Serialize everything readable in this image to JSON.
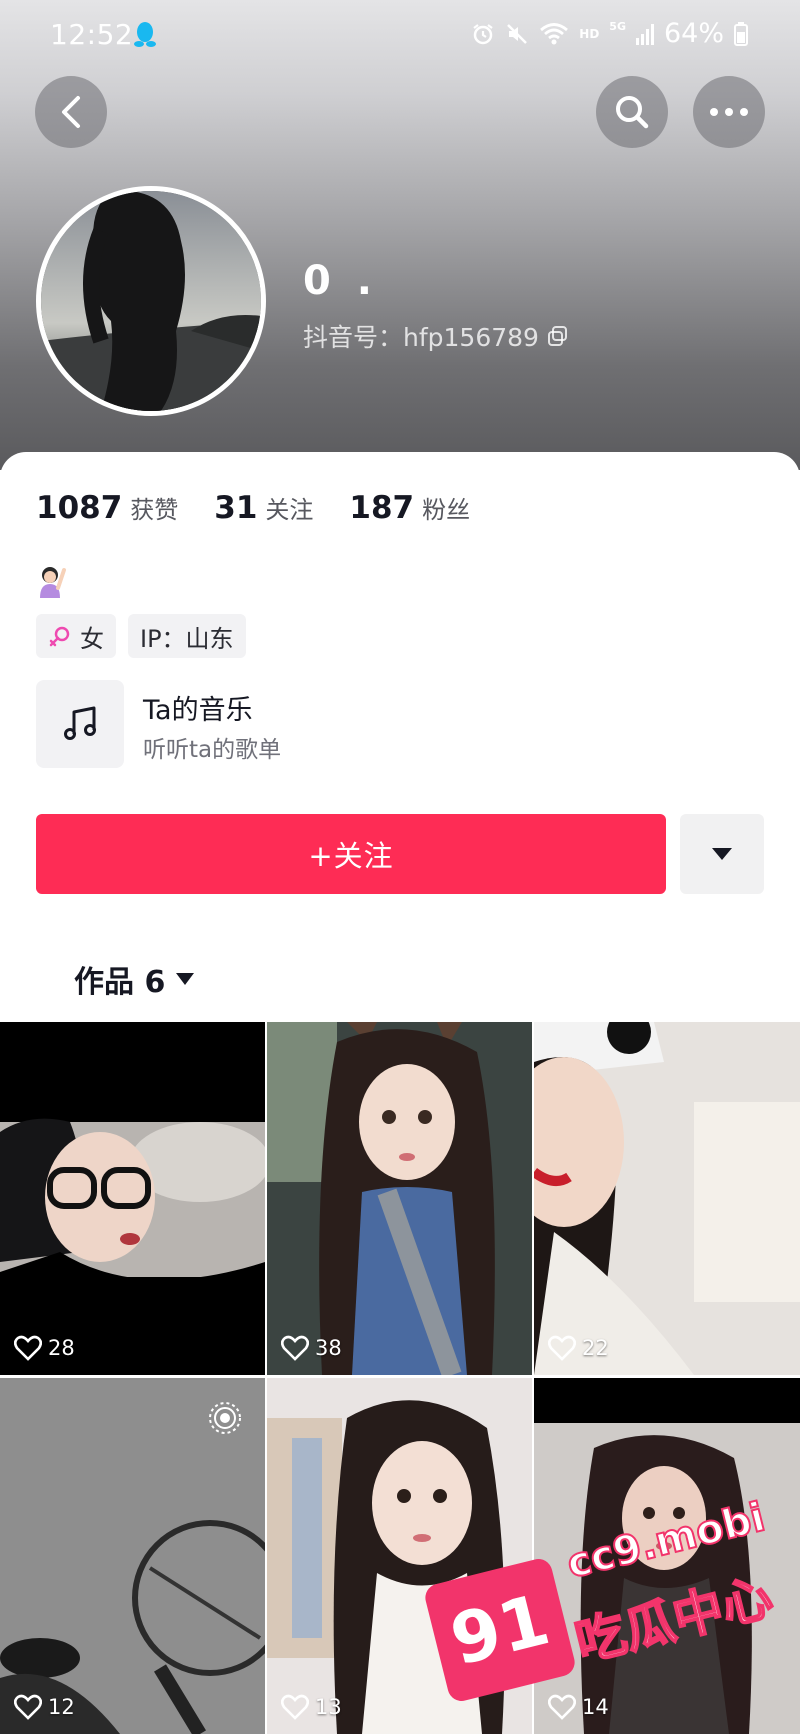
{
  "status_bar": {
    "time": "12:52",
    "network": "HD",
    "signal": "5G",
    "battery": "64%"
  },
  "profile": {
    "name": "0 .",
    "douyin_id": "抖音号：hfp156789"
  },
  "stats": [
    {
      "value": "1087",
      "label": "获赞"
    },
    {
      "value": "31",
      "label": "关注"
    },
    {
      "value": "187",
      "label": "粉丝"
    }
  ],
  "tags": {
    "gender": "女",
    "ip": "IP：山东"
  },
  "music": {
    "title": "Ta的音乐",
    "subtitle": "听听ta的歌单"
  },
  "actions": {
    "follow_label": "+关注"
  },
  "tabs": {
    "works_label": "作品 6"
  },
  "videos": [
    {
      "likes": "28"
    },
    {
      "likes": "38"
    },
    {
      "likes": "22"
    },
    {
      "likes": "12"
    },
    {
      "likes": "13"
    },
    {
      "likes": "14"
    }
  ],
  "watermark": {
    "badge": "91",
    "domain": "cc9.mobi",
    "text": "吃瓜中心"
  },
  "colors": {
    "accent": "#fe2c55",
    "text_primary": "#161823",
    "text_secondary": "#57585f"
  },
  "icons": {
    "back": "chevron-left-icon",
    "search": "search-icon",
    "more": "more-dots-icon",
    "copy": "copy-icon",
    "gender": "female-icon",
    "music": "music-note-icon",
    "dropdown": "caret-down-icon",
    "like": "heart-icon"
  }
}
